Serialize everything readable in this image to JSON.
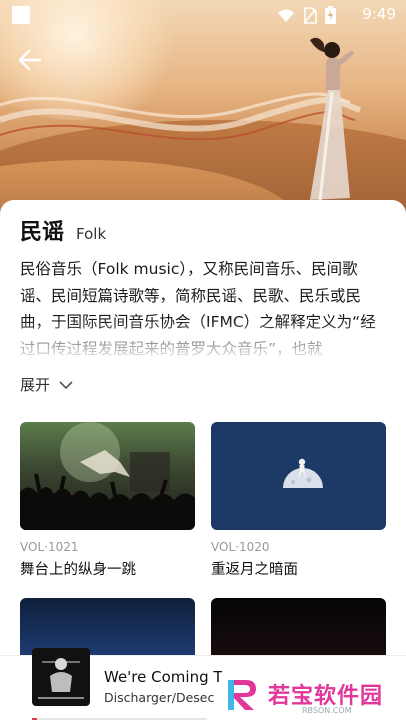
{
  "status_bar": {
    "time": "9:49",
    "icons": [
      "square-icon",
      "wifi-icon",
      "no-sim-icon",
      "battery-charging-icon"
    ]
  },
  "header": {
    "back_icon": "arrow-left-icon"
  },
  "genre": {
    "title_cn": "民谣",
    "title_en": "Folk",
    "description": "民俗音乐（Folk music），又称民间音乐、民间歌谣、民间短篇诗歌等，简称民谣、民歌、民乐或民曲，于国际民间音乐协会（IFMC）之解释定义为“经过口传过程发展起来的普罗大众音乐”，也就",
    "expand_label": "展开"
  },
  "albums": [
    {
      "vol": "VOL·1021",
      "title": "舞台上的纵身一跳",
      "thumb": "concert"
    },
    {
      "vol": "VOL·1020",
      "title": "重返月之暗面",
      "thumb": "moon"
    },
    {
      "vol": "",
      "title": "",
      "thumb": "dark1"
    },
    {
      "vol": "",
      "title": "",
      "thumb": "dark2"
    }
  ],
  "player": {
    "song": "We're Coming T... Y...",
    "artist": "Discharger/Desec",
    "progress": 0.03,
    "accent": "#e0394f"
  },
  "watermark": {
    "name": "若宝软件园",
    "sub": "RBSON.COM"
  }
}
